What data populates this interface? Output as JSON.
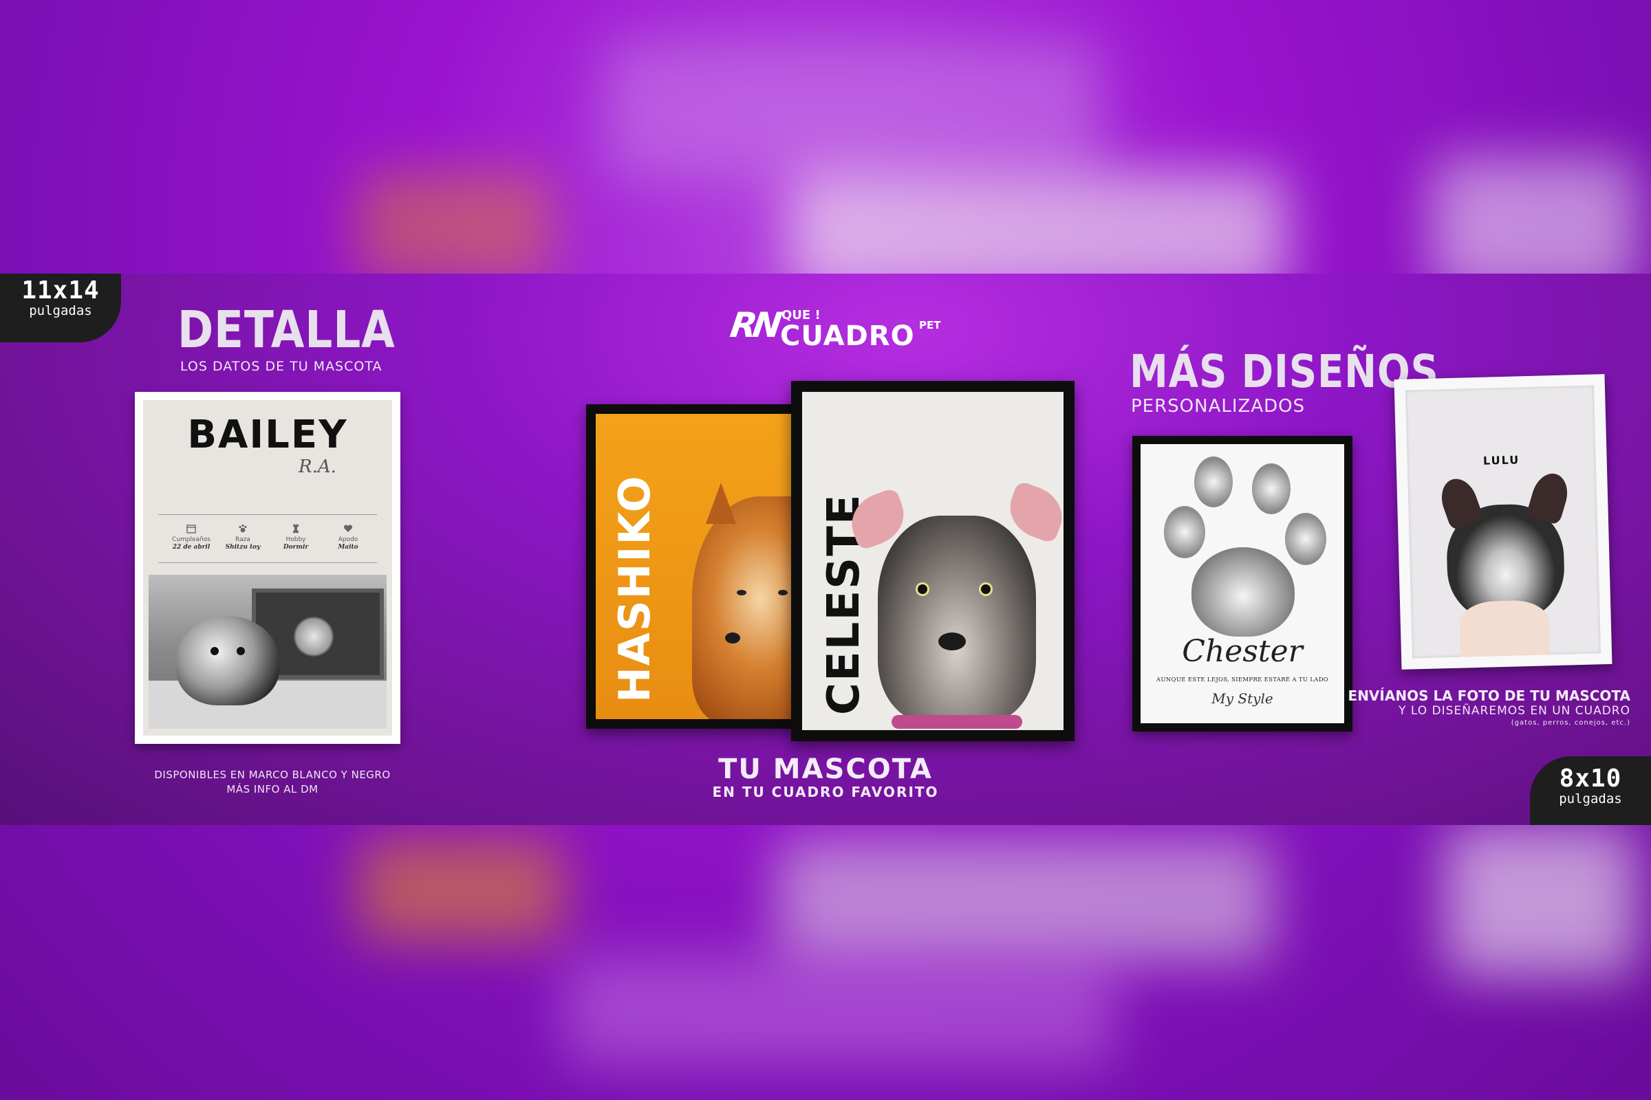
{
  "badge_top_left": {
    "size": "11x14",
    "unit": "pulgadas"
  },
  "badge_bottom_right": {
    "size": "8x10",
    "unit": "pulgadas"
  },
  "left": {
    "title": "DETALLA",
    "subtitle": "LOS DATOS DE TU MASCOTA",
    "poster": {
      "name": "BAILEY",
      "initials": "R.A.",
      "fields": [
        {
          "icon": "calendar-icon",
          "label": "Cumpleaños",
          "value": "22 de abril"
        },
        {
          "icon": "paw-icon",
          "label": "Raza",
          "value": "Shitzu toy"
        },
        {
          "icon": "bone-icon",
          "label": "Hobby",
          "value": "Dormir"
        },
        {
          "icon": "heart-icon",
          "label": "Apodo",
          "value": "Maito"
        }
      ]
    },
    "note_line1": "DISPONIBLES EN MARCO BLANCO Y NEGRO",
    "note_line2": "MÁS INFO AL DM"
  },
  "center": {
    "logo_top": "QUE !",
    "logo_main": "CUADRO",
    "logo_suffix": "PET",
    "logo_mark": "RN",
    "poster1_name": "HASHIKO",
    "poster2_name": "CELESTE",
    "tagline": "TU MASCOTA",
    "tagline_sub": "EN TU CUADRO FAVORITO"
  },
  "right": {
    "title": "MÁS DISEÑOS",
    "subtitle": "PERSONALIZADOS",
    "paw_poster": {
      "name": "Chester",
      "quote": "AUNQUE ESTE LEJOS, SIEMPRE ESTARÉ A TU LADO",
      "signature": "My Style"
    },
    "frame_name": "LULU",
    "cta_bold": "ENVÍANOS LA FOTO DE TU MASCOTA",
    "cta_line2": "Y LO DISEÑAREMOS EN UN CUADRO",
    "cta_line3": "(gatos, perros, conejos, etc.)"
  },
  "colors": {
    "purple": "#9a14d0",
    "dark_purple": "#5a107e",
    "hashiko_orange": "#f0a21c",
    "badge": "#1e1e1e"
  }
}
